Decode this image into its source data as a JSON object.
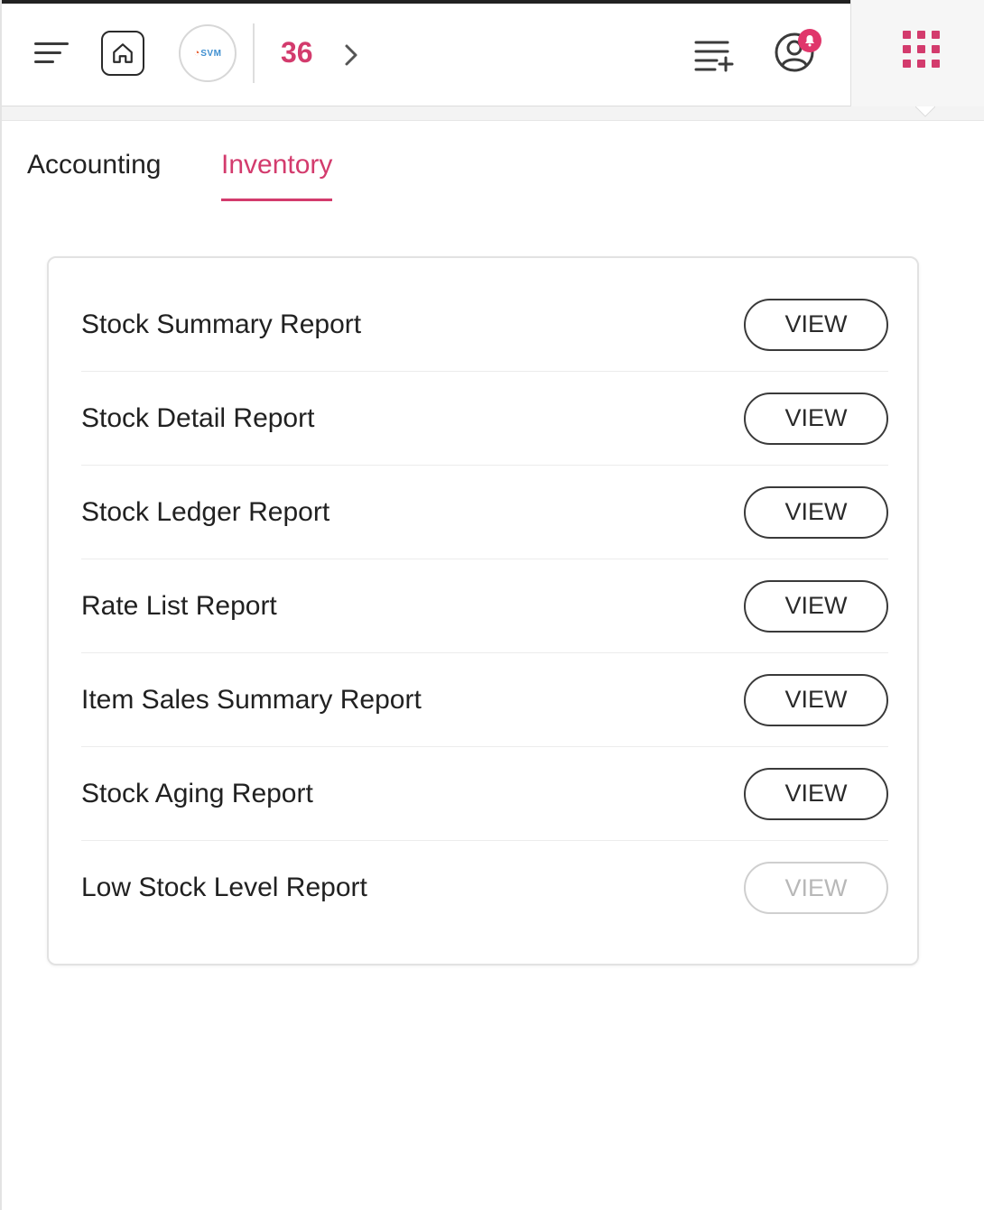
{
  "header": {
    "logo_text": "SVM",
    "counter": "36"
  },
  "tabs": [
    {
      "label": "Accounting",
      "active": false
    },
    {
      "label": "Inventory",
      "active": true
    }
  ],
  "reports": [
    {
      "label": "Stock Summary Report",
      "button": "VIEW",
      "enabled": true
    },
    {
      "label": "Stock Detail Report",
      "button": "VIEW",
      "enabled": true
    },
    {
      "label": "Stock Ledger Report",
      "button": "VIEW",
      "enabled": true
    },
    {
      "label": "Rate List Report",
      "button": "VIEW",
      "enabled": true
    },
    {
      "label": "Item Sales Summary Report",
      "button": "VIEW",
      "enabled": true
    },
    {
      "label": "Stock Aging Report",
      "button": "VIEW",
      "enabled": true
    },
    {
      "label": "Low Stock Level Report",
      "button": "VIEW",
      "enabled": false
    }
  ],
  "colors": {
    "accent": "#d33b6d",
    "badge": "#e0366b",
    "text": "#212121",
    "disabled": "#b8b8b8"
  },
  "icons": {
    "menu": "hamburger-icon",
    "home": "home-icon",
    "next": "chevron-right-icon",
    "add_list": "playlist-add-icon",
    "profile": "user-notification-icon",
    "apps": "apps-grid-icon"
  }
}
